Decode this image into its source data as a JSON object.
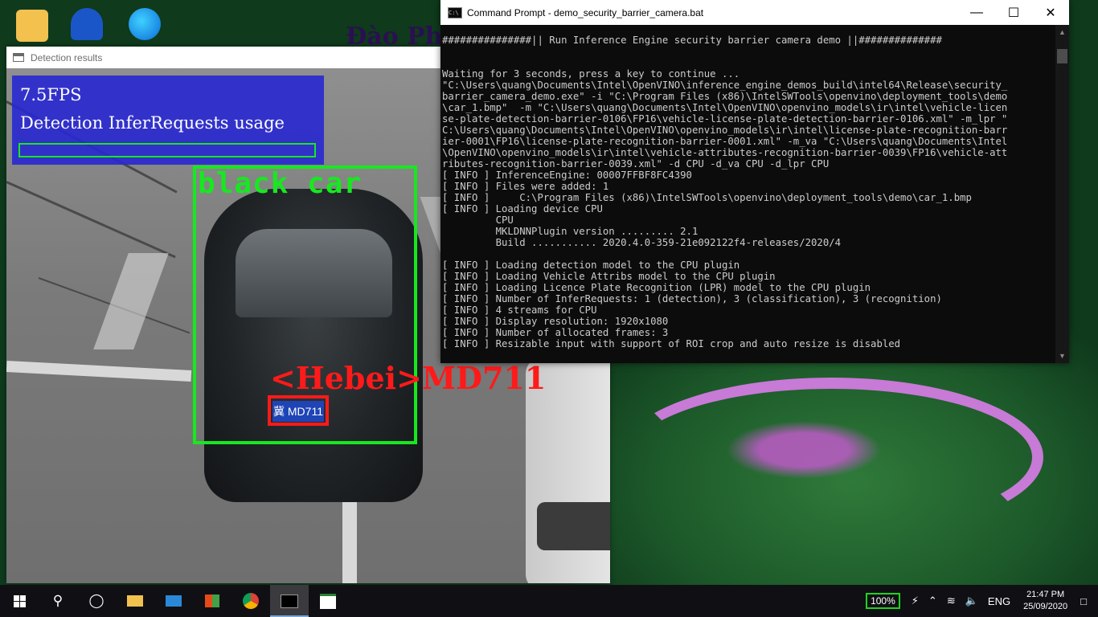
{
  "desktop": {
    "banner_text": "Đào Ph"
  },
  "detection_window": {
    "title": "Detection results",
    "fps": "7.5FPS",
    "usage_label": "Detection InferRequests usage",
    "usage_fraction": 0.0,
    "car_label": "black car",
    "plate_label": "<Hebei>MD711",
    "plate_text": "冀 MD711"
  },
  "cmd_window": {
    "title": "Command Prompt - demo_security_barrier_camera.bat",
    "lines": [
      "###############|| Run Inference Engine security barrier camera demo ||##############",
      "",
      "",
      "Waiting for 3 seconds, press a key to continue ...",
      "\"C:\\Users\\quang\\Documents\\Intel\\OpenVINO\\inference_engine_demos_build\\intel64\\Release\\security_",
      "barrier_camera_demo.exe\" -i \"C:\\Program Files (x86)\\IntelSWTools\\openvino\\deployment_tools\\demo",
      "\\car_1.bmp\"  -m \"C:\\Users\\quang\\Documents\\Intel\\OpenVINO\\openvino_models\\ir\\intel\\vehicle-licen",
      "se-plate-detection-barrier-0106\\FP16\\vehicle-license-plate-detection-barrier-0106.xml\" -m_lpr \"",
      "C:\\Users\\quang\\Documents\\Intel\\OpenVINO\\openvino_models\\ir\\intel\\license-plate-recognition-barr",
      "ier-0001\\FP16\\license-plate-recognition-barrier-0001.xml\" -m_va \"C:\\Users\\quang\\Documents\\Intel",
      "\\OpenVINO\\openvino_models\\ir\\intel\\vehicle-attributes-recognition-barrier-0039\\FP16\\vehicle-att",
      "ributes-recognition-barrier-0039.xml\" -d CPU -d_va CPU -d_lpr CPU",
      "[ INFO ] InferenceEngine: 00007FFBF8FC4390",
      "[ INFO ] Files were added: 1",
      "[ INFO ]     C:\\Program Files (x86)\\IntelSWTools\\openvino\\deployment_tools\\demo\\car_1.bmp",
      "[ INFO ] Loading device CPU",
      "         CPU",
      "         MKLDNNPlugin version ......... 2.1",
      "         Build ........... 2020.4.0-359-21e092122f4-releases/2020/4",
      "",
      "[ INFO ] Loading detection model to the CPU plugin",
      "[ INFO ] Loading Vehicle Attribs model to the CPU plugin",
      "[ INFO ] Loading Licence Plate Recognition (LPR) model to the CPU plugin",
      "[ INFO ] Number of InferRequests: 1 (detection), 3 (classification), 3 (recognition)",
      "[ INFO ] 4 streams for CPU",
      "[ INFO ] Display resolution: 1920x1080",
      "[ INFO ] Number of allocated frames: 3",
      "[ INFO ] Resizable input with support of ROI crop and auto resize is disabled"
    ]
  },
  "taskbar": {
    "battery": "100%",
    "language": "ENG",
    "time": "21:47 PM",
    "date": "25/09/2020"
  },
  "colors": {
    "detection_box": "#17e81f",
    "plate_box": "#ff1a1a",
    "hud_background": "#2828d2"
  }
}
